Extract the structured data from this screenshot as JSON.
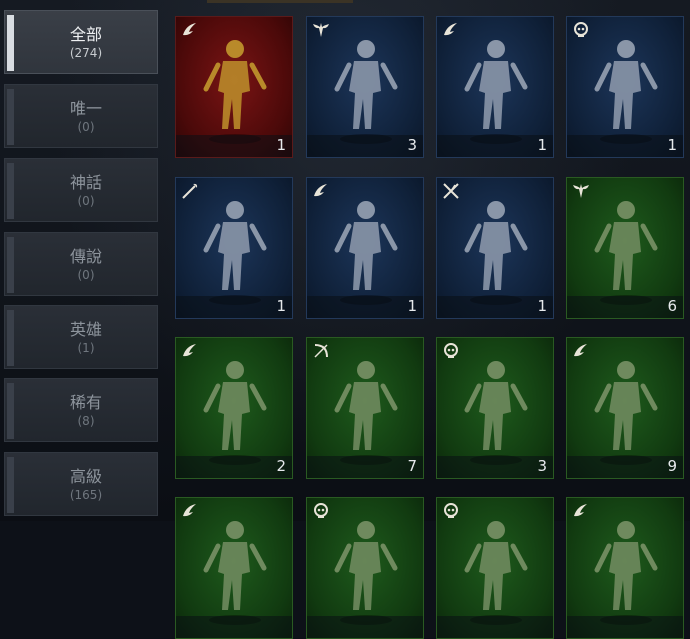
{
  "categories": [
    {
      "name": "全部",
      "count": "(274)",
      "active": true
    },
    {
      "name": "唯一",
      "count": "(0)"
    },
    {
      "name": "神話",
      "count": "(0)"
    },
    {
      "name": "傳說",
      "count": "(0)"
    },
    {
      "name": "英雄",
      "count": "(1)"
    },
    {
      "name": "稀有",
      "count": "(8)"
    },
    {
      "name": "高級",
      "count": "(165)"
    }
  ],
  "cards": [
    {
      "rarity": "red",
      "class_icon": "swoosh-icon",
      "qty": "1"
    },
    {
      "rarity": "blue",
      "class_icon": "wings-icon",
      "qty": "3"
    },
    {
      "rarity": "blue",
      "class_icon": "swoosh-icon",
      "qty": "1"
    },
    {
      "rarity": "blue",
      "class_icon": "skull-icon",
      "qty": "1"
    },
    {
      "rarity": "blue",
      "class_icon": "staff-icon",
      "qty": "1"
    },
    {
      "rarity": "blue",
      "class_icon": "swoosh-icon",
      "qty": "1"
    },
    {
      "rarity": "blue",
      "class_icon": "blades-icon",
      "qty": "1"
    },
    {
      "rarity": "green",
      "class_icon": "wings-icon",
      "qty": "6"
    },
    {
      "rarity": "green",
      "class_icon": "swoosh-icon",
      "qty": "2"
    },
    {
      "rarity": "green",
      "class_icon": "bow-icon",
      "qty": "7"
    },
    {
      "rarity": "green",
      "class_icon": "skull-icon",
      "qty": "3"
    },
    {
      "rarity": "green",
      "class_icon": "swoosh-icon",
      "qty": "9"
    },
    {
      "rarity": "green",
      "class_icon": "swoosh-icon",
      "qty": ""
    },
    {
      "rarity": "green",
      "class_icon": "skull-icon",
      "qty": ""
    },
    {
      "rarity": "green",
      "class_icon": "skull-icon",
      "qty": ""
    },
    {
      "rarity": "green",
      "class_icon": "swoosh-icon",
      "qty": ""
    }
  ],
  "colors": {
    "rarity_red": "#4a0909",
    "rarity_blue": "#0f2038",
    "rarity_green": "#113a10",
    "active_bar": "#d9dde2"
  }
}
